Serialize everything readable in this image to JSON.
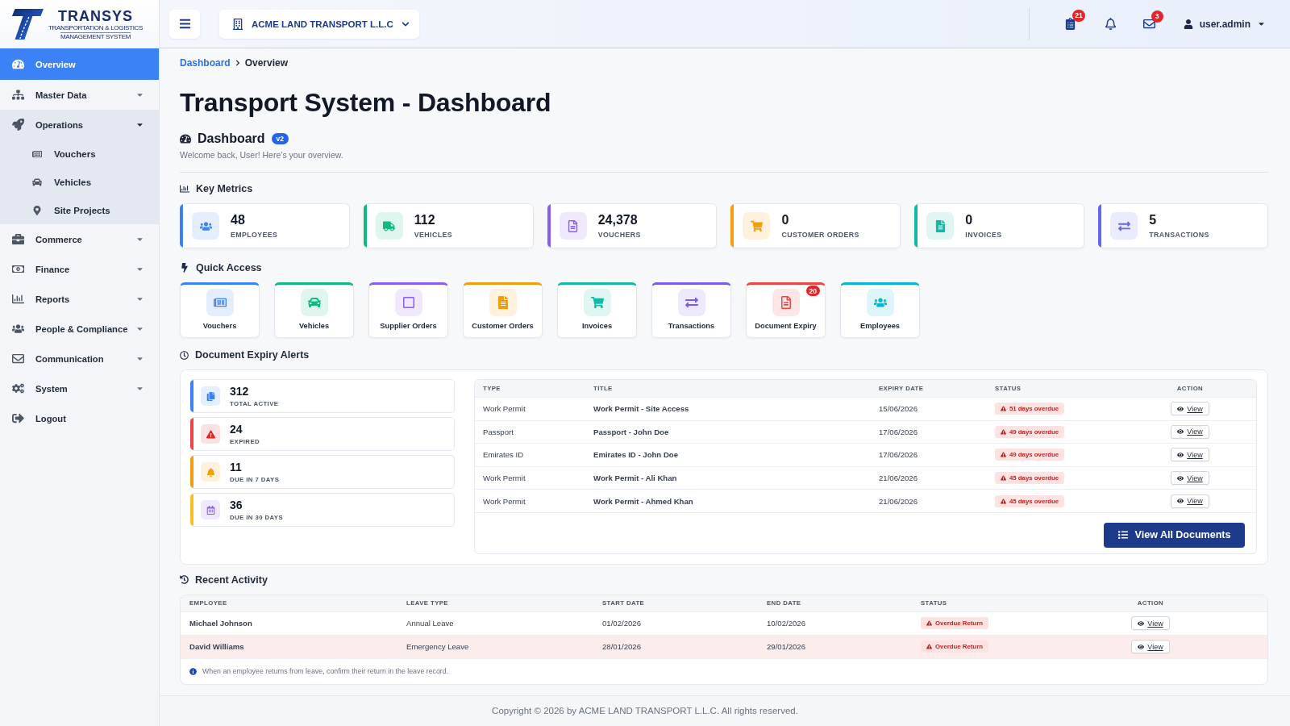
{
  "logo": {
    "name": "TRANSYS",
    "tagline": [
      "TRANSPORTATION & LOGISTICS",
      "MANAGEMENT SYSTEM"
    ]
  },
  "sidebar": {
    "items": [
      {
        "label": "Overview",
        "selected": true
      },
      {
        "label": "Master Data",
        "selected": false,
        "expanded": false
      },
      {
        "label": "Operations",
        "selected": false,
        "expanded": true,
        "children": [
          {
            "label": "Vouchers",
            "selected": false
          },
          {
            "label": "Vehicles",
            "selected": false
          },
          {
            "label": "Site Projects",
            "selected": false
          }
        ]
      },
      {
        "label": "Commerce",
        "selected": false,
        "expanded": false
      },
      {
        "label": "Finance",
        "selected": false,
        "expanded": false
      },
      {
        "label": "Reports",
        "selected": false,
        "expanded": false
      },
      {
        "label": "People & Compliance",
        "selected": false,
        "expanded": false
      },
      {
        "label": "Communication",
        "selected": false,
        "expanded": false
      },
      {
        "label": "System",
        "selected": false,
        "expanded": false
      },
      {
        "label": "Logout",
        "selected": false
      }
    ]
  },
  "header": {
    "company": "ACME LAND TRANSPORT L.L.C",
    "documents_badge": "21",
    "messages_badge": "3",
    "user": "user.admin"
  },
  "breadcrumb": [
    {
      "label": "Dashboard",
      "kind": "link"
    },
    {
      "label": "Overview",
      "kind": "current"
    }
  ],
  "page_title": "Transport System - Dashboard",
  "dashboard": {
    "title": "Dashboard",
    "badge": "v2",
    "welcome": "Welcome back, User! Here’s your overview."
  },
  "key_metrics": {
    "title": "Key Metrics",
    "items": [
      {
        "value": "48",
        "label": "EMPLOYEES",
        "color": "#3b82f6"
      },
      {
        "value": "112",
        "label": "VEHICLES",
        "color": "#10b981"
      },
      {
        "value": "24,378",
        "label": "VOUCHERS",
        "color": "#8b5cf6"
      },
      {
        "value": "0",
        "label": "CUSTOMER ORDERS",
        "color": "#f59e0b"
      },
      {
        "value": "0",
        "label": "INVOICES",
        "color": "#14b8a6"
      },
      {
        "value": "5",
        "label": "TRANSACTIONS",
        "color": "#6366f1"
      }
    ]
  },
  "quick_access": {
    "title": "Quick Access",
    "items": [
      {
        "label": "Vouchers",
        "color": "#3b82f6"
      },
      {
        "label": "Vehicles",
        "color": "#10b981"
      },
      {
        "label": "Supplier Orders",
        "color": "#8b5cf6"
      },
      {
        "label": "Customer Orders",
        "color": "#f59e0b"
      },
      {
        "label": "Invoices",
        "color": "#14b8a6"
      },
      {
        "label": "Transactions",
        "color": "#7c5cf0"
      },
      {
        "label": "Document Expiry",
        "color": "#ef4444",
        "badge": "20"
      },
      {
        "label": "Employees",
        "color": "#06b6d4"
      }
    ]
  },
  "document_expiry_alerts": {
    "title": "Document Expiry Alerts",
    "stats": [
      {
        "value": "312",
        "label": "TOTAL ACTIVE",
        "color": "#3b82f6"
      },
      {
        "value": "24",
        "label": "EXPIRED",
        "color": "#ef4444"
      },
      {
        "value": "11",
        "label": "DUE IN 7 DAYS",
        "color": "#f59e0b"
      },
      {
        "value": "36",
        "label": "DUE IN 30 DAYS",
        "color": "#fbbf24"
      }
    ],
    "table": {
      "columns": [
        "TYPE",
        "TITLE",
        "EXPIRY DATE",
        "STATUS",
        "ACTION"
      ],
      "rows": [
        {
          "type": "Work Permit",
          "title": "Work Permit - Site Access",
          "expiry_date": "15/06/2026",
          "status": "51 days overdue",
          "action": "View"
        },
        {
          "type": "Passport",
          "title": "Passport - John Doe",
          "expiry_date": "17/06/2026",
          "status": "49 days overdue",
          "action": "View"
        },
        {
          "type": "Emirates ID",
          "title": "Emirates ID - John Doe",
          "expiry_date": "17/06/2026",
          "status": "49 days overdue",
          "action": "View"
        },
        {
          "type": "Work Permit",
          "title": "Work Permit - Ali Khan",
          "expiry_date": "21/06/2026",
          "status": "45 days overdue",
          "action": "View"
        },
        {
          "type": "Work Permit",
          "title": "Work Permit - Ahmed Khan",
          "expiry_date": "21/06/2026",
          "status": "45 days overdue",
          "action": "View"
        }
      ]
    },
    "view_all_button": "View All Documents"
  },
  "recent_activity": {
    "title": "Recent Activity",
    "table": {
      "columns": [
        "EMPLOYEE",
        "LEAVE TYPE",
        "START DATE",
        "END DATE",
        "STATUS",
        "ACTION"
      ],
      "rows": [
        {
          "employee": "Michael Johnson",
          "leave_type": "Annual Leave",
          "start_date": "01/02/2026",
          "end_date": "10/02/2026",
          "status": "Overdue Return",
          "action": "View",
          "highlighted": false
        },
        {
          "employee": "David Williams",
          "leave_type": "Emergency Leave",
          "start_date": "28/01/2026",
          "end_date": "29/01/2026",
          "status": "Overdue Return",
          "action": "View",
          "highlighted": true
        }
      ]
    },
    "note": "When an employee returns from leave, confirm their return in the leave record."
  },
  "footer": "Copyright © 2026 by ACME LAND TRANSPORT L.L.C. All rights reserved."
}
